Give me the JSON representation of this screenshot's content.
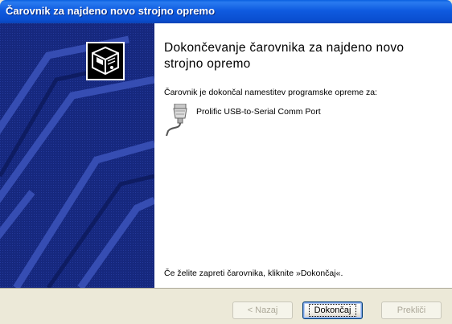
{
  "window": {
    "title": "Čarovnik za najdeno novo strojno opremo"
  },
  "main": {
    "heading": "Dokončevanje čarovnika za najdeno novo strojno opremo",
    "intro": "Čarovnik je dokončal namestitev programske opreme za:",
    "device_name": "Prolific USB-to-Serial Comm Port",
    "footer_text": "Če želite zapreti čarovnika, kliknite »Dokončaj«."
  },
  "buttons": {
    "back_label": "< Nazaj",
    "finish_label": "Dokončaj",
    "cancel_label": "Prekliči"
  },
  "icons": {
    "wizard": "hardware-wizard-icon",
    "device": "serial-port-icon"
  },
  "colors": {
    "titlebar": "#0a5fe0",
    "side_panel": "#16287e",
    "dialog_background": "#ece9d8"
  }
}
